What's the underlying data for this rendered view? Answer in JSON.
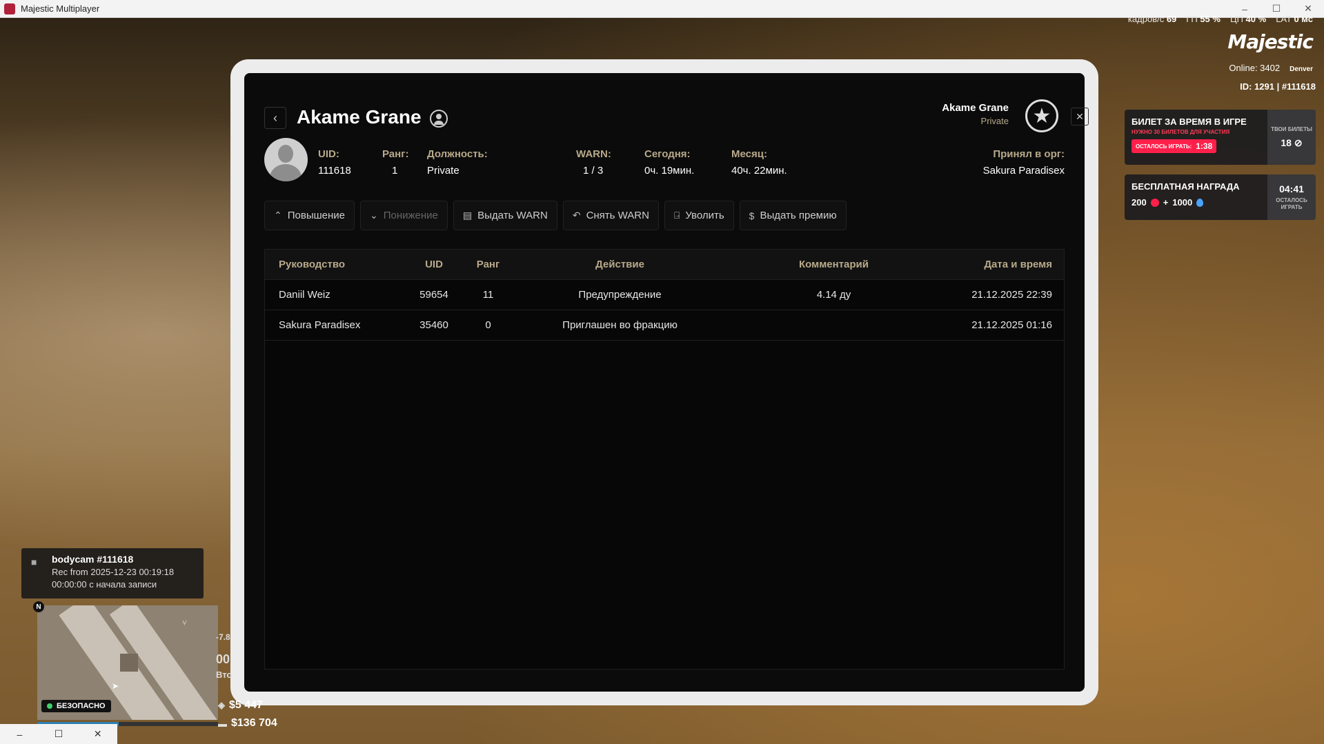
{
  "window": {
    "title": "Majestic Multiplayer",
    "minimize": "–",
    "maximize": "☐",
    "close": "✕"
  },
  "hud": {
    "perf": [
      {
        "label": "кадров/с",
        "value": "69"
      },
      {
        "label": "ГП",
        "value": "55 %"
      },
      {
        "label": "ЦП",
        "value": "40 %"
      },
      {
        "label": "LAT",
        "value": "0 мс"
      }
    ],
    "logo": "Majestic",
    "online": "Online: 3402",
    "server": "Denver",
    "id_line": "ID: 1291 | #111618",
    "ticket": {
      "title": "БИЛЕТ ЗА ВРЕМЯ В ИГРЕ",
      "subtitle": "НУЖНО 30 БИЛЕТОВ ДЛЯ УЧАСТИЯ",
      "timer_label": "ОСТАЛОСЬ ИГРАТЬ:",
      "timer_value": "1:38",
      "side_label": "ТВОИ БИЛЕТЫ",
      "side_value": "18"
    },
    "reward": {
      "title": "БЕСПЛАТНАЯ НАГРАДА",
      "amount_a": "200",
      "plus": "+",
      "amount_b": "1000",
      "timer": "04:41",
      "side_label": "ОСТАЛОСЬ ИГРАТЬ"
    },
    "bodycam": {
      "title": "bodycam #111618",
      "rec": "Rec from 2025-12-23 00:19:18",
      "elapsed": "00:00:00 с начала записи"
    },
    "compass": "N",
    "zone": "БЕЗОПАСНО",
    "health_fraction": 0.45,
    "cash": "$5 447",
    "bank": "$136 704",
    "side_a": "-7.8",
    "side_b": "00",
    "side_c": "Вто"
  },
  "tablet": {
    "title": "Akame Grane",
    "user_name": "Akame Grane",
    "user_rank": "Private",
    "stats": {
      "uid_label": "UID:",
      "uid": "111618",
      "rank_label": "Ранг:",
      "rank": "1",
      "position_label": "Должность:",
      "position": "Private",
      "warn_label": "WARN:",
      "warn": "1 / 3",
      "today_label": "Сегодня:",
      "today": "0ч. 19мин.",
      "month_label": "Месяц:",
      "month": "40ч. 22мин.",
      "accepted_label": "Принял в орг:",
      "accepted": "Sakura Paradisex"
    },
    "actions": {
      "promote": "Повышение",
      "demote": "Понижение",
      "give_warn": "Выдать WARN",
      "remove_warn": "Снять WARN",
      "fire": "Уволить",
      "bonus": "Выдать премию"
    },
    "table": {
      "headers": [
        "Руководство",
        "UID",
        "Ранг",
        "Действие",
        "Комментарий",
        "Дата и время"
      ],
      "rows": [
        [
          "Daniil Weiz",
          "59654",
          "11",
          "Предупреждение",
          "4.14 ду",
          "21.12.2025 22:39"
        ],
        [
          "Sakura Paradisex",
          "35460",
          "0",
          "Приглашен во фракцию",
          "",
          "21.12.2025 01:16"
        ]
      ]
    }
  }
}
